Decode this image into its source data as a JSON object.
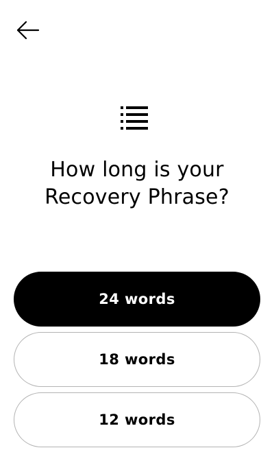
{
  "header": {
    "back_icon": "arrow-left-icon"
  },
  "hero": {
    "icon": "list-icon",
    "title_line1": "How long is your",
    "title_line2": "Recovery Phrase?"
  },
  "options": [
    {
      "label": "24 words",
      "selected": true
    },
    {
      "label": "18 words",
      "selected": false
    },
    {
      "label": "12 words",
      "selected": false
    }
  ],
  "colors": {
    "selected_bg": "#000000",
    "selected_text": "#ffffff",
    "unselected_border": "#b3b3b3"
  }
}
